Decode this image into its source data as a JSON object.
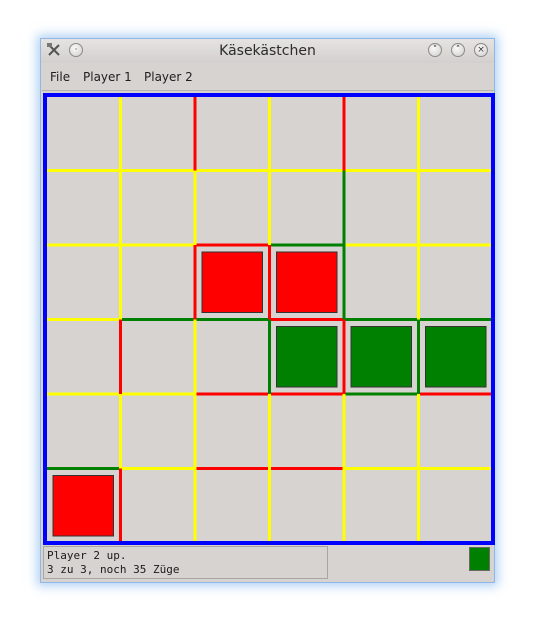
{
  "window": {
    "title": "Käsekästchen"
  },
  "menu": {
    "items": [
      {
        "label": "File"
      },
      {
        "label": "Player 1"
      },
      {
        "label": "Player 2"
      }
    ]
  },
  "colors": {
    "border": "#0000ff",
    "empty_line": "#ffff00",
    "player1": "#ff0000",
    "player2": "#008000",
    "cell_bg": "#d6d3d1"
  },
  "board": {
    "rows": 6,
    "cols": 6,
    "h_lines": [
      [
        "y",
        "y",
        "y",
        "y",
        "y",
        "y"
      ],
      [
        "y",
        "y",
        "r",
        "g",
        "y",
        "y"
      ],
      [
        "y",
        "g",
        "g",
        "r",
        "g",
        "g"
      ],
      [
        "y",
        "y",
        "r",
        "r",
        "g",
        "r"
      ],
      [
        "g",
        "y",
        "r",
        "r",
        "y",
        "y"
      ]
    ],
    "v_lines": [
      [
        "y",
        "r",
        "y",
        "r",
        "y"
      ],
      [
        "y",
        "y",
        "y",
        "g",
        "y"
      ],
      [
        "y",
        "r",
        "r",
        "g",
        "y"
      ],
      [
        "r",
        "y",
        "g",
        "r",
        "g"
      ],
      [
        "y",
        "y",
        "y",
        "y",
        "y"
      ],
      [
        "r",
        "y",
        "y",
        "y",
        "y"
      ]
    ],
    "boxes": [
      {
        "row": 2,
        "col": 2,
        "owner": "r"
      },
      {
        "row": 2,
        "col": 3,
        "owner": "r"
      },
      {
        "row": 3,
        "col": 3,
        "owner": "g"
      },
      {
        "row": 3,
        "col": 4,
        "owner": "g"
      },
      {
        "row": 3,
        "col": 5,
        "owner": "g"
      },
      {
        "row": 5,
        "col": 0,
        "owner": "r"
      }
    ]
  },
  "status": {
    "line1": "Player 2 up.",
    "line2": "3 zu 3, noch 35 Züge",
    "current_player_color": "#008000"
  }
}
